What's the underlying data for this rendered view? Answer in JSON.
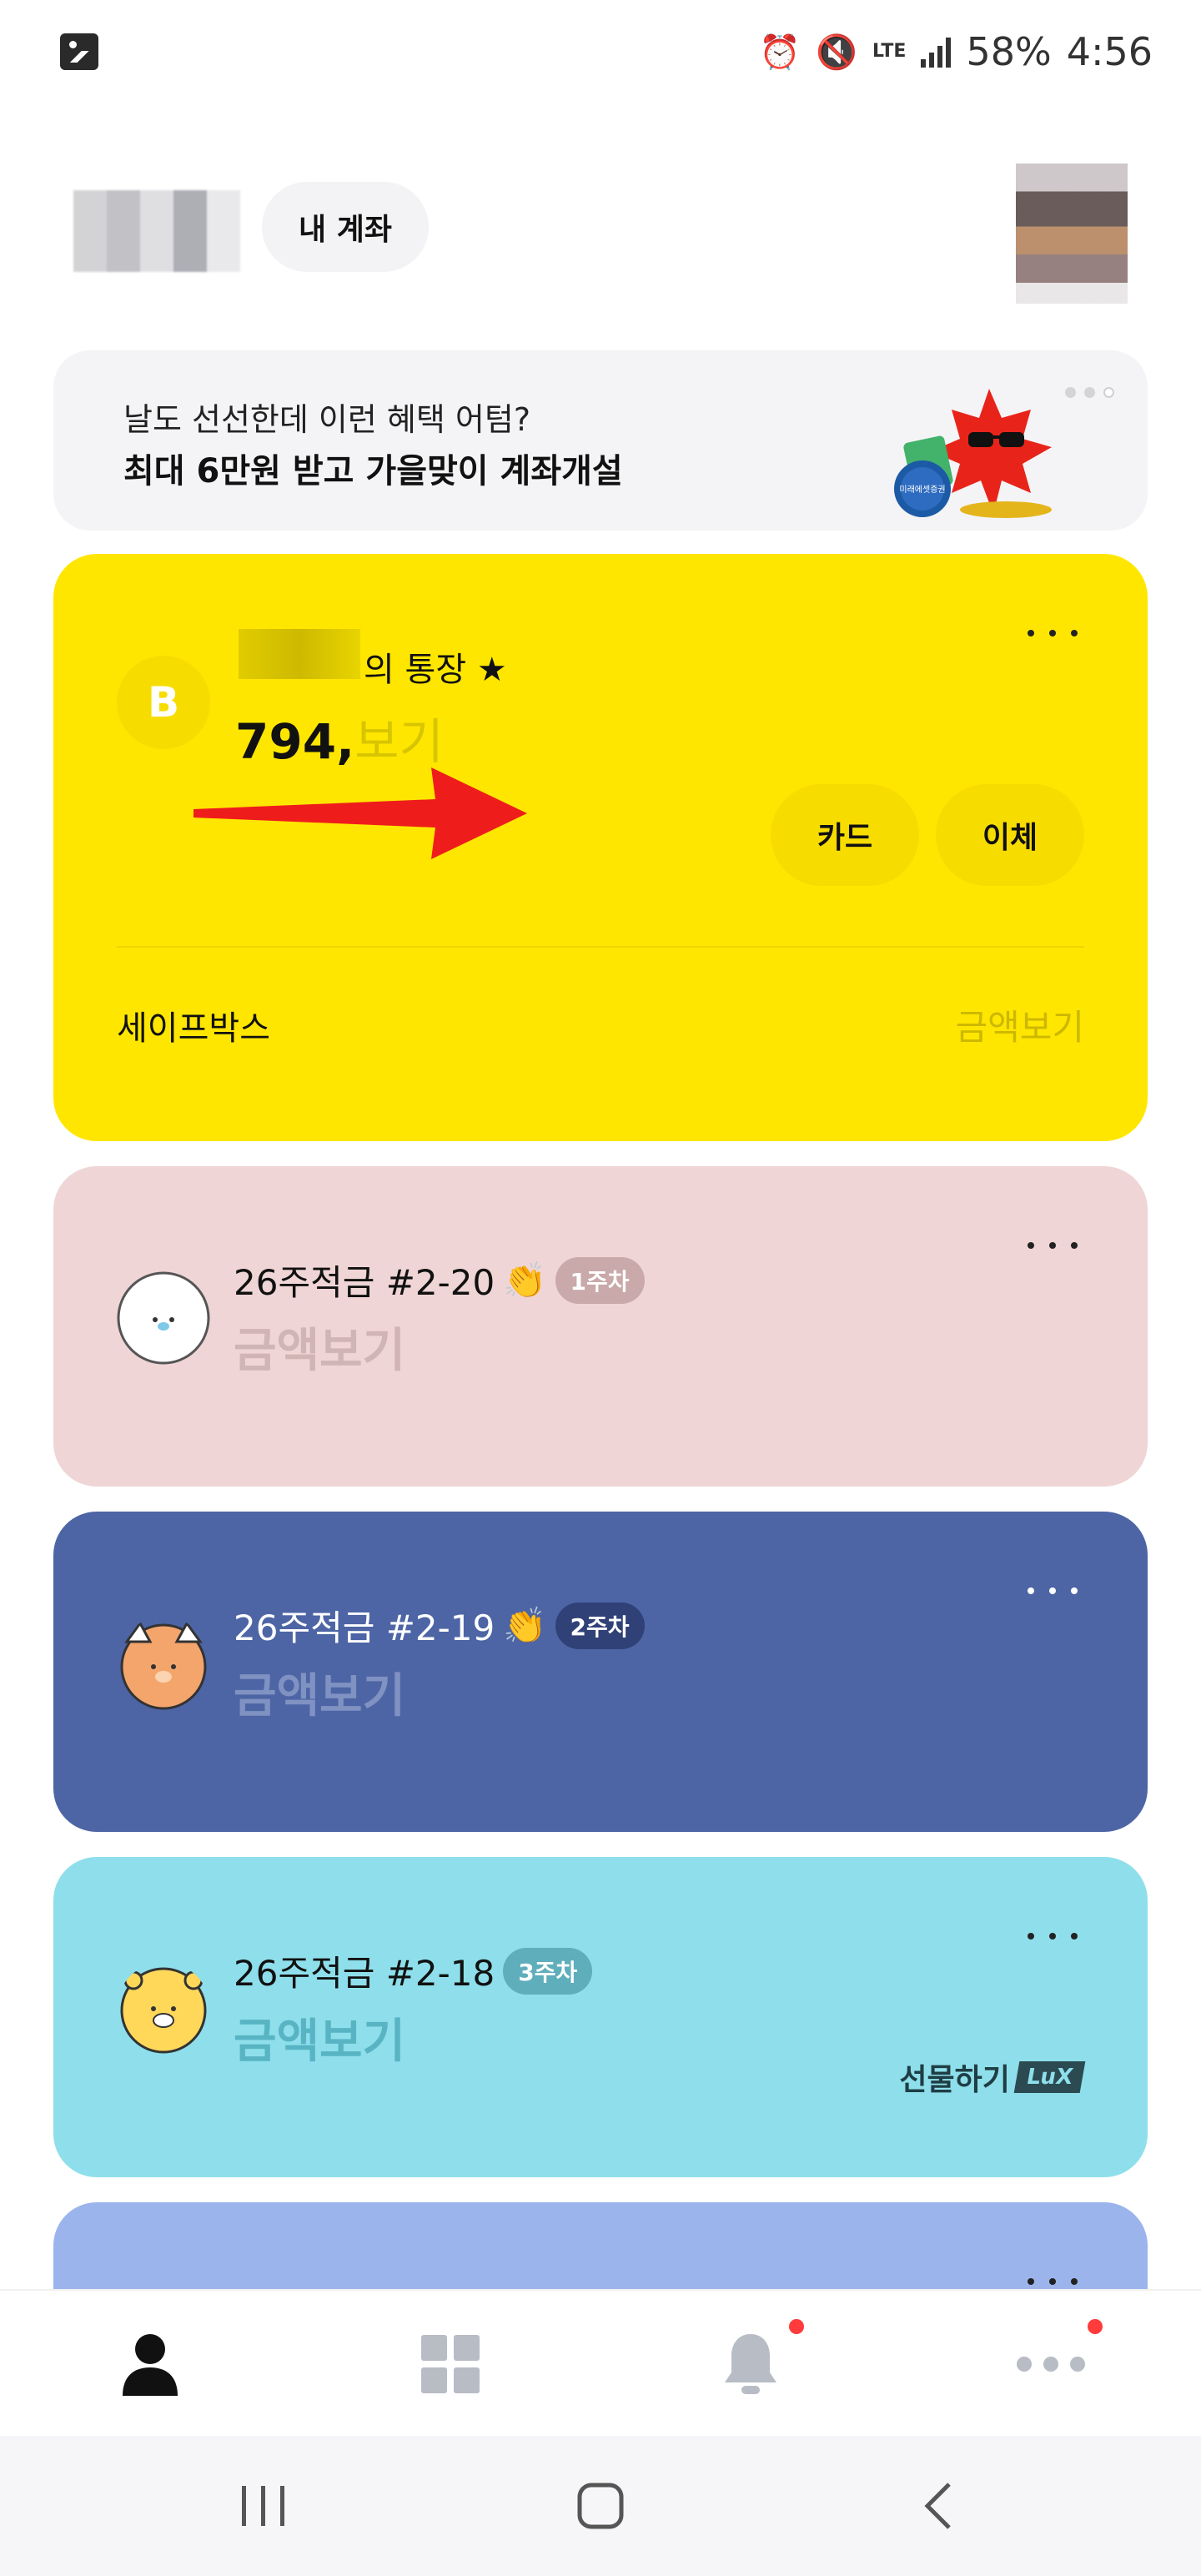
{
  "status_bar": {
    "battery": "58%",
    "time": "4:56",
    "network": "LTE",
    "icons": [
      "gallery-icon",
      "alarm-icon",
      "mute-icon",
      "lte-icon",
      "signal-icon"
    ]
  },
  "header": {
    "account_button": "내 계좌"
  },
  "promo": {
    "line1": "날도 선선한데 이런 혜택 어텀?",
    "line2": "최대 6만원 받고 가을맞이 계좌개설",
    "art_label": "미래에셋증권"
  },
  "main_account": {
    "bank_letter": "B",
    "name_suffix": "의 통장",
    "balance_visible": "794,",
    "balance_hidden": "보기",
    "buttons": {
      "card": "카드",
      "transfer": "이체"
    },
    "safebox_label": "세이프박스",
    "safebox_amount": "금액보기"
  },
  "savings": [
    {
      "title": "26주적금 #2-20",
      "emoji": "👏",
      "badge": "1주차",
      "amount": "금액보기"
    },
    {
      "title": "26주적금 #2-19",
      "emoji": "👏",
      "badge": "2주차",
      "amount": "금액보기"
    },
    {
      "title": "26주적금 #2-18",
      "badge": "3주차",
      "amount": "금액보기",
      "gift_label": "선물하기",
      "gift_tag": "LuX"
    }
  ],
  "colors": {
    "main_card": "#ffe600",
    "pink_card": "#efd5d5",
    "navy_card": "#4d65a5",
    "cyan_card": "#8edfeb",
    "blue_card": "#9bb4ec",
    "notification_dot": "#ff3b3b"
  }
}
